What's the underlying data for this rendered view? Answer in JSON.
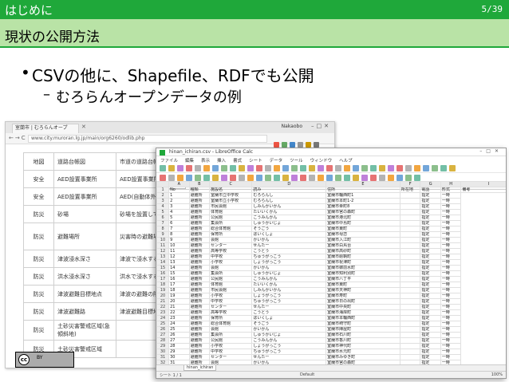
{
  "header": {
    "section": "はじめに",
    "page": "5/39"
  },
  "title": "現状の公開方法",
  "bullets": {
    "main": "CSVの他に、Shapefile、RDFでも公開",
    "sub": "むろらんオープンデータの例"
  },
  "colors": {
    "accent": "#1fa83a",
    "title_band": "#b9e3a6"
  },
  "browser": {
    "tab_title": "室蘭市 | むろらんオープ",
    "user": "Nakaobo",
    "url": "www.city.muroran.lg.jp/main/org6260/odlib.php",
    "rows": [
      {
        "cat": "地図",
        "name": "道路台帳図",
        "desc": "市道の道路台帳図です。"
      },
      {
        "cat": "安全",
        "name": "AED設置事業所",
        "desc": "AED設置事業所の一覧"
      },
      {
        "cat": "安全",
        "name": "AED設置事業所",
        "desc": "AED(自動体外式除細動器)を設置"
      },
      {
        "cat": "防災",
        "name": "砂場",
        "desc": "砂場を設置している場所"
      },
      {
        "cat": "防災",
        "name": "避難場所",
        "desc": "災害時の避難場所 オープンデータプラットフォームでダウンロードできます。"
      },
      {
        "cat": "防災",
        "name": "津波浸水深さ",
        "desc": "津波で浸水する深さの予測図"
      },
      {
        "cat": "防災",
        "name": "洪水浸水深さ",
        "desc": "洪水で浸水する深さの予測図"
      },
      {
        "cat": "防災",
        "name": "津波避難目標地点",
        "desc": "津波の避難の際に目指すべき目標"
      },
      {
        "cat": "防災",
        "name": "津波避難路",
        "desc": "津波避難目標地点から避難場所まで"
      },
      {
        "cat": "防災",
        "name": "土砂災害警戒区域(急傾斜地)",
        "desc": ""
      },
      {
        "cat": "防災",
        "name": "土砂災害警戒区域",
        "desc": ""
      }
    ],
    "license": {
      "cc": "cc",
      "by": "BY"
    }
  },
  "calc": {
    "window_title": "hinan_ichiran.csv - LibreOffice Calc",
    "menu": [
      "ファイル",
      "編集",
      "表示",
      "挿入",
      "書式",
      "シート",
      "データ",
      "ツール",
      "ウィンドウ",
      "ヘルプ"
    ],
    "name_box": "A1",
    "columns": [
      "",
      "A",
      "B",
      "C",
      "D",
      "E",
      "F",
      "G",
      "H",
      "I"
    ],
    "header_row": [
      "No",
      "種類",
      "施設名",
      "読み",
      "住所",
      "所在地",
      "電話",
      "形式",
      "備考"
    ],
    "rows": [
      [
        "2",
        "1",
        "避難所",
        "室蘭市立中学校",
        "むろらんし",
        "室蘭市輪西町1",
        "",
        "指定",
        "一時"
      ],
      [
        "3",
        "2",
        "避難所",
        "室蘭市立小学校",
        "むろらんし",
        "室蘭市本町1-2",
        "",
        "指定",
        "一時"
      ],
      [
        "4",
        "3",
        "避難所",
        "市民会館",
        "しみんかいかん",
        "室蘭市幸町8",
        "",
        "指定",
        "一時"
      ],
      [
        "5",
        "4",
        "避難所",
        "体育館",
        "たいいくかん",
        "室蘭市宮の森町",
        "",
        "指定",
        "一時"
      ],
      [
        "6",
        "5",
        "避難所",
        "公民館",
        "こうみんかん",
        "室蘭市港北町",
        "",
        "指定",
        "一時"
      ],
      [
        "7",
        "6",
        "避難所",
        "集会所",
        "しゅうかいじょ",
        "室蘭市中島町",
        "",
        "指定",
        "一時"
      ],
      [
        "8",
        "7",
        "避難所",
        "総合体育館",
        "そうごう",
        "室蘭市東町",
        "",
        "指定",
        "一時"
      ],
      [
        "9",
        "8",
        "避難所",
        "保育所",
        "ほいくしょ",
        "室蘭市母恋",
        "",
        "指定",
        "一時"
      ],
      [
        "10",
        "9",
        "避難所",
        "会館",
        "かいかん",
        "室蘭市入江町",
        "",
        "指定",
        "一時"
      ],
      [
        "11",
        "10",
        "避難所",
        "センター",
        "せんたー",
        "室蘭市白鳥台",
        "",
        "指定",
        "一時"
      ],
      [
        "12",
        "11",
        "避難所",
        "高等学校",
        "こうとう",
        "室蘭市高砂町",
        "",
        "指定",
        "一時"
      ],
      [
        "13",
        "12",
        "避難所",
        "中学校",
        "ちゅうがっこう",
        "室蘭市絵鞆町",
        "",
        "指定",
        "一時"
      ],
      [
        "14",
        "13",
        "避難所",
        "小学校",
        "しょうがっこう",
        "室蘭市祝津町",
        "",
        "指定",
        "一時"
      ],
      [
        "15",
        "14",
        "避難所",
        "会館",
        "かいかん",
        "室蘭市御前水町",
        "",
        "指定",
        "一時"
      ],
      [
        "16",
        "15",
        "避難所",
        "集会所",
        "しゅうかいじょ",
        "室蘭市知利別町",
        "",
        "指定",
        "一時"
      ],
      [
        "17",
        "16",
        "避難所",
        "公民館",
        "こうみんかん",
        "室蘭市八丁平",
        "",
        "指定",
        "一時"
      ],
      [
        "18",
        "17",
        "避難所",
        "体育館",
        "たいいくかん",
        "室蘭市東町",
        "",
        "指定",
        "一時"
      ],
      [
        "19",
        "18",
        "避難所",
        "市民会館",
        "しみんかいかん",
        "室蘭市天神町",
        "",
        "指定",
        "一時"
      ],
      [
        "20",
        "19",
        "避難所",
        "小学校",
        "しょうがっこう",
        "室蘭市寿町",
        "",
        "指定",
        "一時"
      ],
      [
        "21",
        "20",
        "避難所",
        "中学校",
        "ちゅうがっこう",
        "室蘭市日の出町",
        "",
        "指定",
        "一時"
      ],
      [
        "22",
        "21",
        "避難所",
        "センター",
        "せんたー",
        "室蘭市中央町",
        "",
        "指定",
        "一時"
      ],
      [
        "23",
        "22",
        "避難所",
        "高等学校",
        "こうとう",
        "室蘭市海岸町",
        "",
        "指定",
        "一時"
      ],
      [
        "24",
        "23",
        "避難所",
        "保育所",
        "ほいくしょ",
        "室蘭市本輪西町",
        "",
        "指定",
        "一時"
      ],
      [
        "25",
        "24",
        "避難所",
        "総合体育館",
        "そうごう",
        "室蘭市崎守町",
        "",
        "指定",
        "一時"
      ],
      [
        "26",
        "25",
        "避難所",
        "会館",
        "かいかん",
        "室蘭市陣屋町",
        "",
        "指定",
        "一時"
      ],
      [
        "27",
        "26",
        "避難所",
        "集会所",
        "しゅうかいじょ",
        "室蘭市石川町",
        "",
        "指定",
        "一時"
      ],
      [
        "28",
        "27",
        "避難所",
        "公民館",
        "こうみんかん",
        "室蘭市香川町",
        "",
        "指定",
        "一時"
      ],
      [
        "29",
        "28",
        "避難所",
        "小学校",
        "しょうがっこう",
        "室蘭市神代町",
        "",
        "指定",
        "一時"
      ],
      [
        "30",
        "29",
        "避難所",
        "中学校",
        "ちゅうがっこう",
        "室蘭市水元町",
        "",
        "指定",
        "一時"
      ],
      [
        "31",
        "30",
        "避難所",
        "センター",
        "せんたー",
        "室蘭市みゆき町",
        "",
        "指定",
        "一時"
      ],
      [
        "32",
        "31",
        "避難所",
        "会館",
        "かいかん",
        "室蘭市宮の森町",
        "",
        "指定",
        "一時"
      ]
    ],
    "sheet_tab": "hinan_ichiran",
    "status_left": "シート 1 / 1",
    "status_mid": "Default",
    "zoom": "100%"
  }
}
